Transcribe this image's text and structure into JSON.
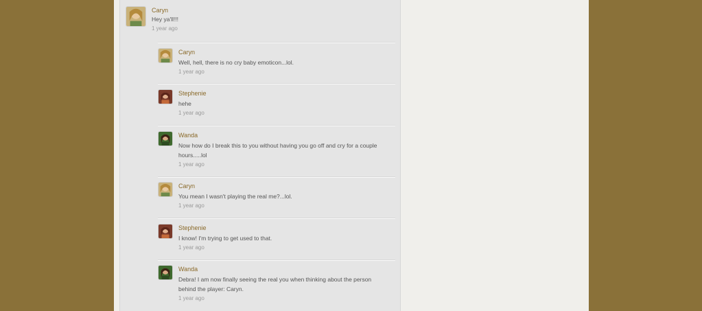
{
  "thread": {
    "top_comment": {
      "author": "Caryn",
      "text": "Hey ya'll!!!",
      "time": "1 year ago"
    },
    "replies": [
      {
        "author": "Caryn",
        "avatar": "caryn-avatar",
        "text": "Well, hell, there is no cry baby emoticon...lol.",
        "time": "1 year ago"
      },
      {
        "author": "Stephenie",
        "avatar": "stephenie-avatar",
        "text": "hehe",
        "time": "1 year ago"
      },
      {
        "author": "Wanda",
        "avatar": "wanda-avatar",
        "text": "Now how do I break this to you without having you go off and cry for a couple hours.....lol",
        "time": "1 year ago"
      },
      {
        "author": "Caryn",
        "avatar": "caryn-avatar",
        "text": "You mean I wasn't playing the real me?...lol.",
        "time": "1 year ago"
      },
      {
        "author": "Stephenie",
        "avatar": "stephenie-avatar",
        "text": "I know! I'm trying to get used to that.",
        "time": "1 year ago"
      },
      {
        "author": "Wanda",
        "avatar": "wanda-avatar",
        "text": "Debra!  I am now finally seeing the real you when thinking about the person behind the player: Caryn.",
        "time": "1 year ago"
      }
    ]
  },
  "colors": {
    "outer_background": "#8a7139",
    "page_background": "#f0efeb",
    "thread_background": "#e5e5e5",
    "author_link": "#8a6a2a"
  }
}
